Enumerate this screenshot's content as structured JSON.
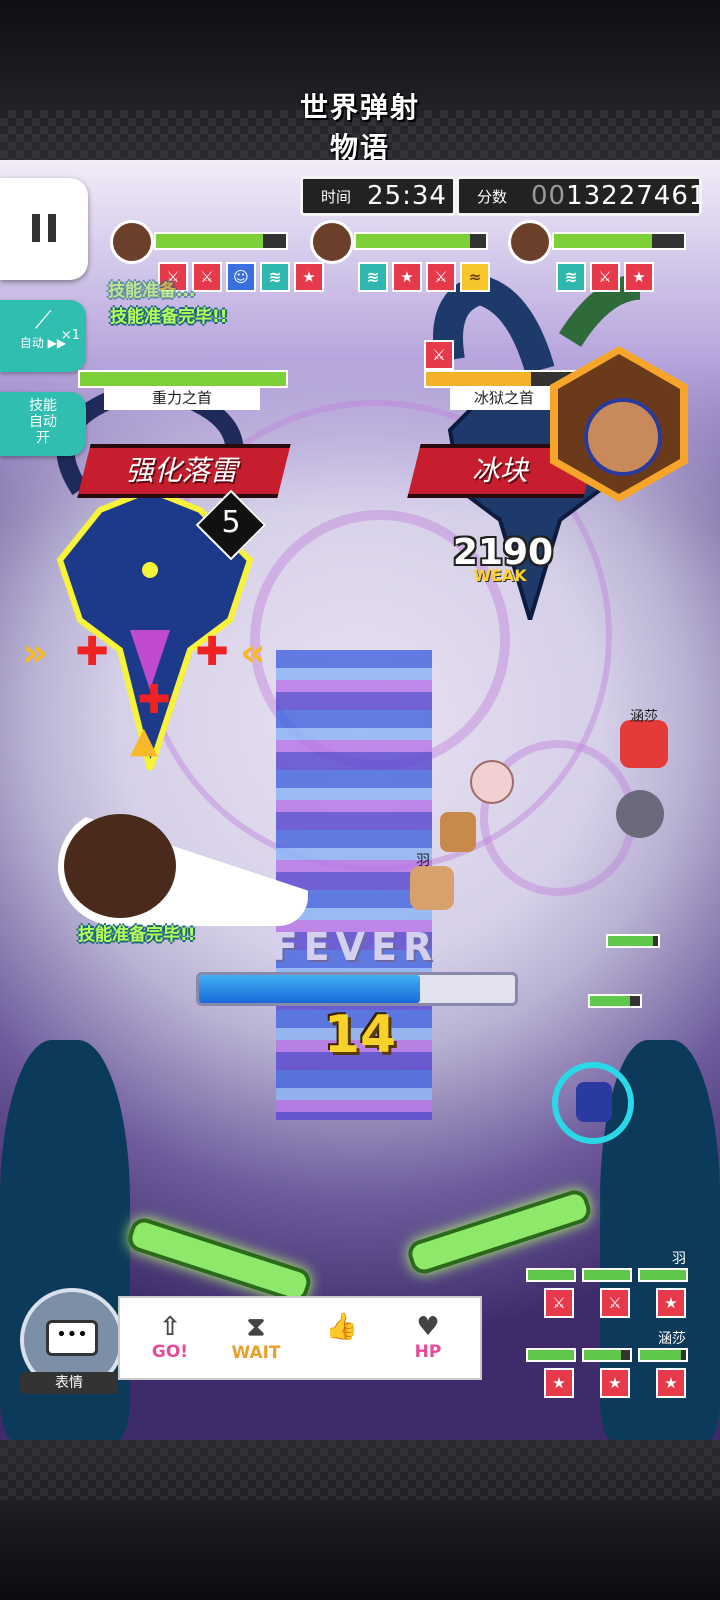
{
  "header": {
    "logo": "世界弹射物语"
  },
  "hud": {
    "time_label": "时间",
    "time_value": "25:34",
    "score_label": "分数",
    "score_prefix": "00",
    "score_value": "13227461"
  },
  "party": [
    {
      "hp": 0.82,
      "skills": [
        "sword",
        "sword",
        "hero",
        "wing",
        "star"
      ]
    },
    {
      "hp": 0.88,
      "skills": [
        "wing",
        "star",
        "sword",
        "flame"
      ]
    },
    {
      "hp": 0.75,
      "skills": [
        "wing",
        "sword",
        "star"
      ]
    }
  ],
  "controls": {
    "auto": {
      "multiplier": "×1",
      "label": "自动 ▶▶"
    },
    "skill_auto": {
      "line1": "技能",
      "line2": "自动",
      "state": "开"
    }
  },
  "bosses": [
    {
      "name": "重力之首",
      "hp": 1.0,
      "banner": "强化落雷",
      "counter": "5"
    },
    {
      "name": "冰狱之首",
      "hp": 0.7,
      "banner": "冰块"
    }
  ],
  "messages": {
    "skill_ready": "技能准备完毕!!",
    "skill_ready_top2": "技能准备完毕!!",
    "skill_ready_top1": "技能准备..."
  },
  "damage": {
    "value": "2190",
    "tag": "WEAK"
  },
  "fever": {
    "label": "FEVER",
    "fill": 0.7,
    "combo": "14"
  },
  "characters": {
    "xiansha": "涵莎",
    "yu": "羽"
  },
  "right_panel": [
    {
      "name": "羽",
      "bars": [
        1.0,
        1.0,
        1.0
      ],
      "skills": [
        "sword",
        "sword",
        "star"
      ]
    },
    {
      "name": "涵莎",
      "bars": [
        1.0,
        0.8,
        0.9
      ],
      "skills": [
        "star",
        "star",
        "star"
      ]
    }
  ],
  "emotes": {
    "button_label": "表情",
    "items": [
      {
        "icon": "arrow-icon",
        "label": "GO!"
      },
      {
        "icon": "hourglass-icon",
        "label": "WAIT"
      },
      {
        "icon": "thumbs-up-icon",
        "label": ""
      },
      {
        "icon": "heart-icon",
        "label": "HP"
      }
    ]
  },
  "colors": {
    "accent": "#2fbeb0",
    "banner": "#c61e2e",
    "hp": "#7ed03a",
    "fever": "#1a6ad8"
  }
}
